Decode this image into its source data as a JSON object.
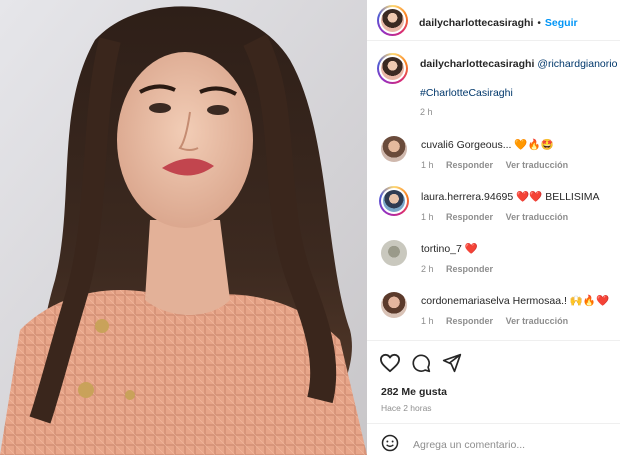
{
  "post": {
    "author": "dailycharlottecasiraghi",
    "follow_label": "Seguir",
    "separator": "•",
    "caption_mention": "@richardgianorio",
    "hashtag": "#CharlotteCasiraghi",
    "caption_time": "2 h"
  },
  "comments": [
    {
      "user": "cuvali6",
      "text": "Gorgeous...",
      "emoji": "🧡🔥🤩",
      "time": "1 h",
      "reply": "Responder",
      "translate": "Ver traducción"
    },
    {
      "user": "laura.herrera.94695",
      "text": "BELLISIMA",
      "emoji": "❤️❤️",
      "time": "1 h",
      "reply": "Responder",
      "translate": "Ver traducción"
    },
    {
      "user": "tortino_7",
      "text": "",
      "emoji": "❤️",
      "time": "2 h",
      "reply": "Responder",
      "translate": ""
    },
    {
      "user": "cordonemariaselva",
      "text": "Hermosaa.!",
      "emoji": "🙌🔥❤️",
      "time": "1 h",
      "reply": "Responder",
      "translate": "Ver traducción"
    }
  ],
  "footer": {
    "likes": "282 Me gusta",
    "time_ago": "Hace 2 horas",
    "comment_placeholder": "Agrega un comentario..."
  },
  "colors": {
    "accent": "#0095f6",
    "link": "#00376b",
    "muted": "#8e8e8e"
  }
}
